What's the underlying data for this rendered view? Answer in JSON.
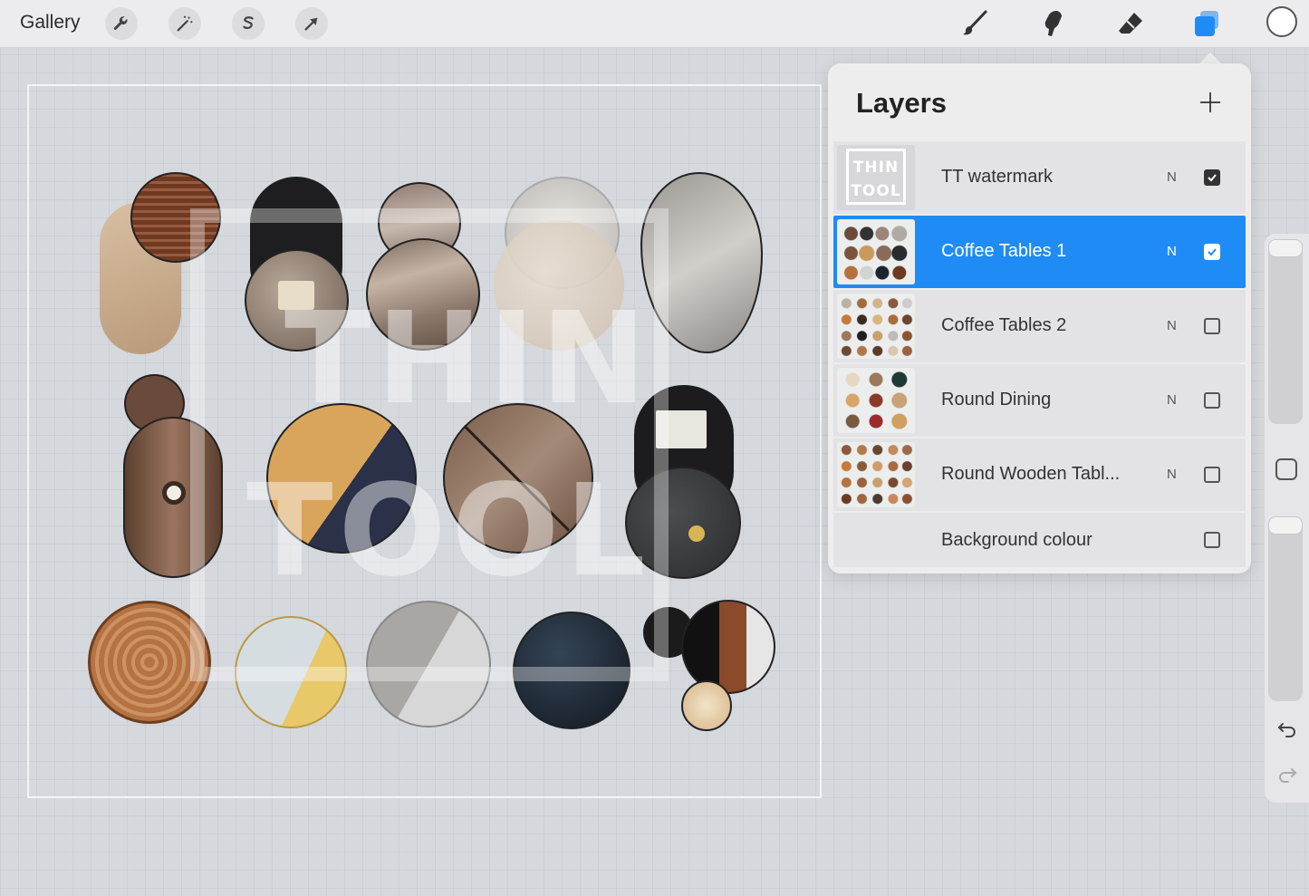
{
  "toolbar": {
    "gallery_label": "Gallery",
    "left_tools": [
      "wrench-icon",
      "magic-wand-icon",
      "selection-s-icon",
      "transform-arrow-icon"
    ],
    "right_tools": [
      "brush-icon",
      "smudge-icon",
      "eraser-icon",
      "layers-icon"
    ],
    "active_tool": "layers-icon",
    "accent_color": "#1f8cf5",
    "current_color": "#ffffff"
  },
  "layers_panel": {
    "title": "Layers",
    "add_icon": "plus-icon",
    "layers": [
      {
        "name": "TT watermark",
        "blend": "N",
        "visible": true,
        "selected": false,
        "thumb_text": "THIN TOOL"
      },
      {
        "name": "Coffee Tables 1",
        "blend": "N",
        "visible": true,
        "selected": true
      },
      {
        "name": "Coffee Tables 2",
        "blend": "N",
        "visible": false,
        "selected": false
      },
      {
        "name": "Round Dining",
        "blend": "N",
        "visible": false,
        "selected": false
      },
      {
        "name": "Round Wooden Tabl...",
        "blend": "N",
        "visible": false,
        "selected": false
      },
      {
        "name": "Background colour",
        "visible": false,
        "selected": false
      }
    ]
  },
  "canvas": {
    "watermark_line1": "THIN",
    "watermark_line2": "TOOL"
  },
  "side_panel": {
    "icons": [
      "modify-square-icon",
      "undo-icon",
      "redo-icon"
    ]
  }
}
